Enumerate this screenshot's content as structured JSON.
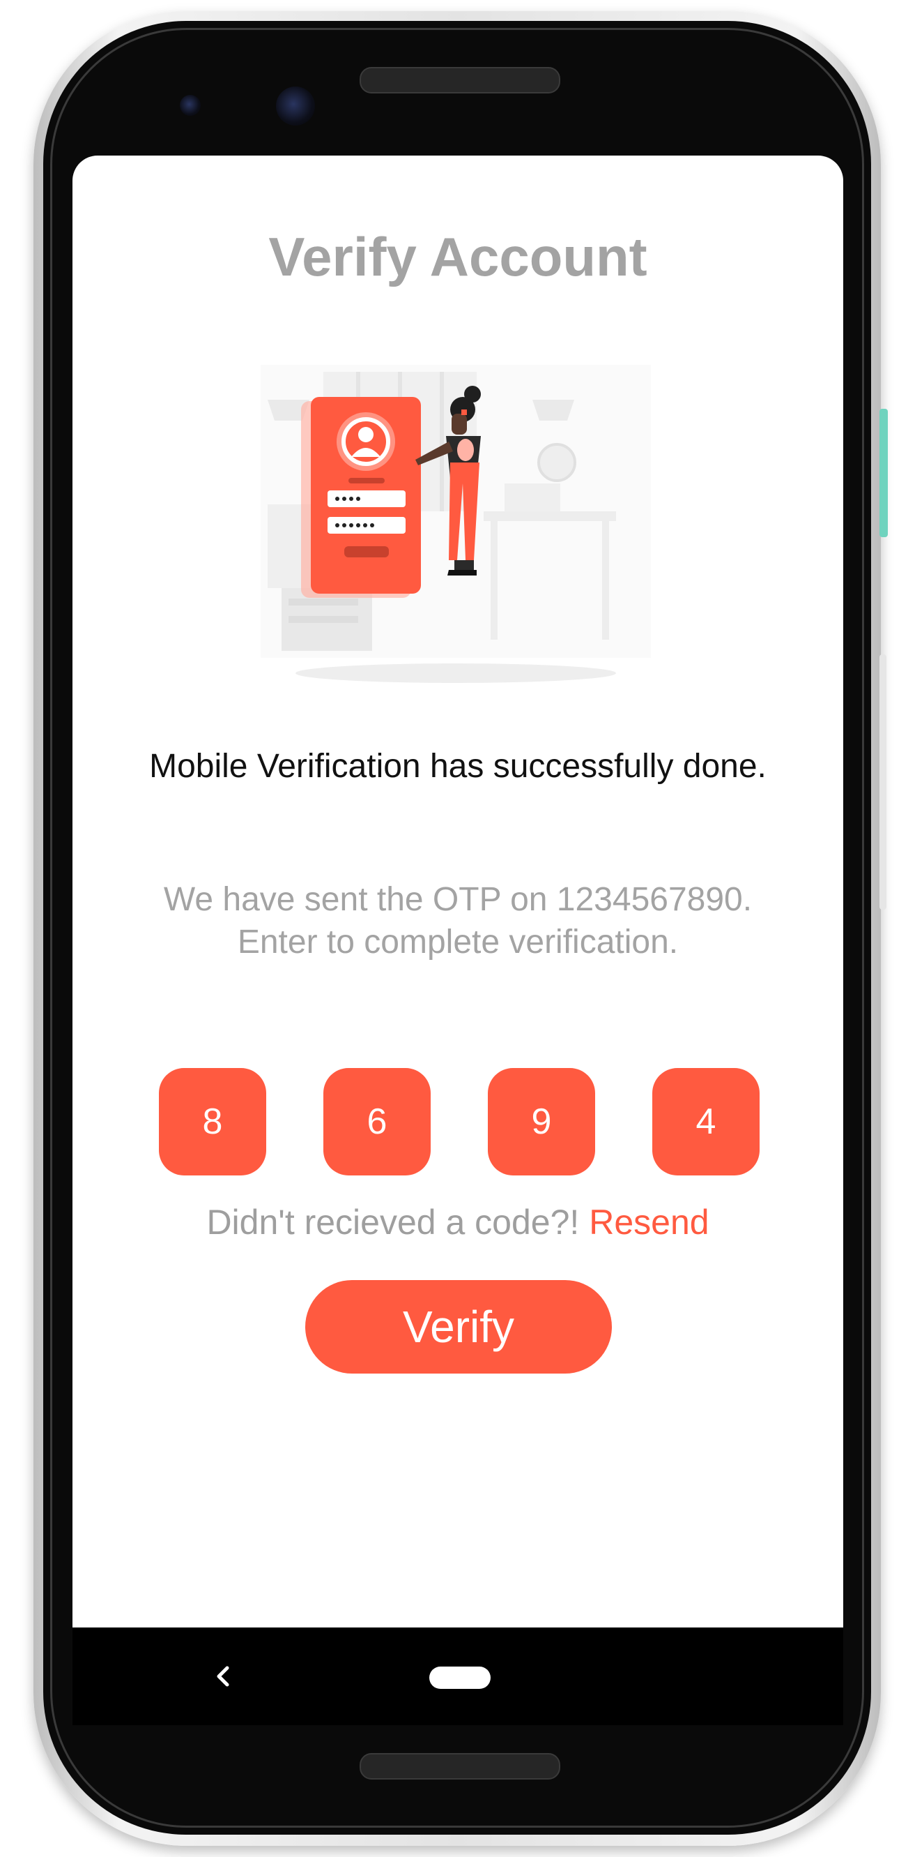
{
  "screen": {
    "title": "Verify Account",
    "success_message": "Mobile Verification has successfully done.",
    "otp_message": "We have sent the OTP on 1234567890. Enter to complete verification.",
    "otp_digits": [
      "8",
      "6",
      "9",
      "4"
    ],
    "resend_prompt": "Didn't recieved a code?!",
    "resend_label": "Resend",
    "verify_label": "Verify"
  },
  "colors": {
    "accent": "#ff5a40",
    "title_gray": "#a3a3a3",
    "text_dark": "#111111",
    "nav_background": "#000000"
  },
  "icons": {
    "illustration": "user-login-illustration",
    "back": "chevron-left-icon",
    "home": "home-pill-icon"
  }
}
